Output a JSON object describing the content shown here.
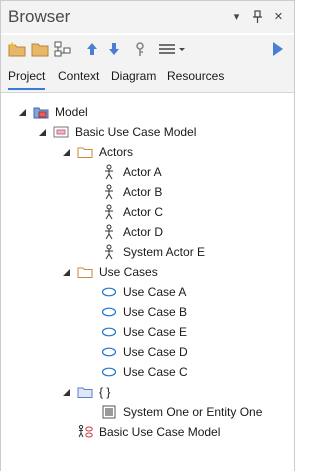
{
  "window": {
    "title": "Browser",
    "buttons": [
      "dropdown",
      "pin",
      "close"
    ]
  },
  "toolbar": {
    "tools": [
      "new-package-icon",
      "folder-icon",
      "diagram-icon",
      "arrow-up-icon",
      "arrow-down-icon",
      "link-icon",
      "menu-icon",
      "play-icon"
    ]
  },
  "tabs": [
    {
      "label": "Project",
      "active": true
    },
    {
      "label": "Context",
      "active": false
    },
    {
      "label": "Diagram",
      "active": false
    },
    {
      "label": "Resources",
      "active": false
    }
  ],
  "tree": [
    {
      "label": "Model",
      "icon": "model-root-icon",
      "expanded": true
    },
    {
      "label": "Basic Use Case Model",
      "icon": "package-icon",
      "expanded": true
    },
    {
      "label": "Actors",
      "icon": "folder-icon",
      "expanded": true
    },
    {
      "label": "Actor A",
      "icon": "actor-icon"
    },
    {
      "label": "Actor B",
      "icon": "actor-icon"
    },
    {
      "label": "Actor C",
      "icon": "actor-icon"
    },
    {
      "label": "Actor D",
      "icon": "actor-icon"
    },
    {
      "label": "System Actor E",
      "icon": "actor-icon"
    },
    {
      "label": "Use Cases",
      "icon": "folder-icon",
      "expanded": true
    },
    {
      "label": "Use Case A",
      "icon": "use-case-icon"
    },
    {
      "label": "Use Case B",
      "icon": "use-case-icon"
    },
    {
      "label": "Use Case E",
      "icon": "use-case-icon"
    },
    {
      "label": "Use Case D",
      "icon": "use-case-icon"
    },
    {
      "label": "Use Case C",
      "icon": "use-case-icon"
    },
    {
      "label": "{ }",
      "icon": "folder-blue-icon",
      "expanded": true
    },
    {
      "label": "System One or Entity One",
      "icon": "boundary-icon"
    },
    {
      "label": "Basic Use Case Model",
      "icon": "use-case-diagram-icon"
    }
  ],
  "colors": {
    "accent": "#3a7bd5",
    "folder": "#c98a3c",
    "use_case": "#1f78d1"
  }
}
